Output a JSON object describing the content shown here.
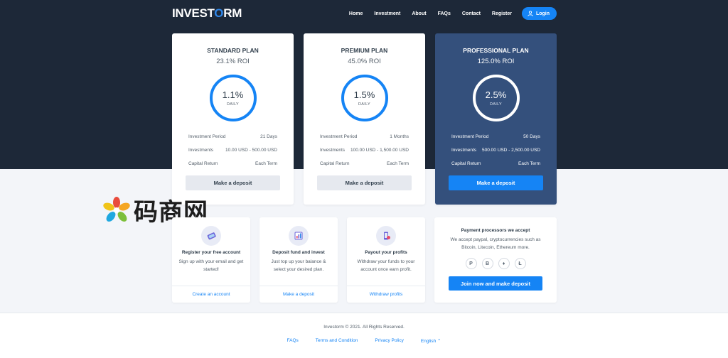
{
  "header": {
    "logo": "INVESTORM",
    "menu": [
      {
        "label": "Home"
      },
      {
        "label": "Investment"
      },
      {
        "label": "About"
      },
      {
        "label": "FAQs"
      },
      {
        "label": "Contact"
      },
      {
        "label": "Register"
      }
    ],
    "login_label": "Login"
  },
  "plans": [
    {
      "name": "STANDARD PLAN",
      "roi": "23.1% ROI",
      "daily_value": "1.1%",
      "daily_label": "DAILY",
      "rows": [
        {
          "label": "Investment Period",
          "value": "21 Days"
        },
        {
          "label": "Investments",
          "value": "10.00 USD - 500.00 USD"
        },
        {
          "label": "Capital Return",
          "value": "Each Term"
        }
      ],
      "button": "Make a deposit"
    },
    {
      "name": "PREMIUM PLAN",
      "roi": "45.0% ROI",
      "daily_value": "1.5%",
      "daily_label": "DAILY",
      "rows": [
        {
          "label": "Investment Period",
          "value": "1 Months"
        },
        {
          "label": "Investments",
          "value": "100.00 USD - 1,500.00 USD"
        },
        {
          "label": "Capital Return",
          "value": "Each Term"
        }
      ],
      "button": "Make a deposit"
    },
    {
      "name": "PROFESSIONAL PLAN",
      "roi": "125.0% ROI",
      "daily_value": "2.5%",
      "daily_label": "DAILY",
      "rows": [
        {
          "label": "Investment Period",
          "value": "50 Days"
        },
        {
          "label": "Investments",
          "value": "500.00 USD - 2,500.00 USD"
        },
        {
          "label": "Capital Return",
          "value": "Each Term"
        }
      ],
      "button": "Make a deposit"
    }
  ],
  "steps": [
    {
      "icon": "phone-icon",
      "title": "Register your free account",
      "desc": "Sign up with your email and get started!",
      "link": "Create an account"
    },
    {
      "icon": "chart-icon",
      "title": "Deposit fund and invest",
      "desc": "Just top up your balance & select your desired plan.",
      "link": "Make a deposit"
    },
    {
      "icon": "payout-icon",
      "title": "Payout your profits",
      "desc": "Withdraw your funds to your account once earn profit.",
      "link": "Withdraw profits"
    }
  ],
  "processors": {
    "title": "Payment processors we accept",
    "desc": "We accept paypal, cryptocurrencies such as Bitcoin, Litecoin, Ethereum more.",
    "coins": [
      "paypal-icon",
      "bitcoin-icon",
      "ethereum-icon",
      "litecoin-icon"
    ],
    "button": "Join now and make deposit"
  },
  "watermark": {
    "text": "码商网"
  },
  "footer": {
    "copyright": "Investorm © 2021. All Rights Reserved.",
    "links": [
      {
        "label": "FAQs"
      },
      {
        "label": "Terms and Condition"
      },
      {
        "label": "Privacy Policy"
      },
      {
        "label": "English ⌃"
      }
    ]
  },
  "colors": {
    "accent": "#1584f5",
    "hero_bg": "#1d2838",
    "pro_bg": "#34507c"
  }
}
